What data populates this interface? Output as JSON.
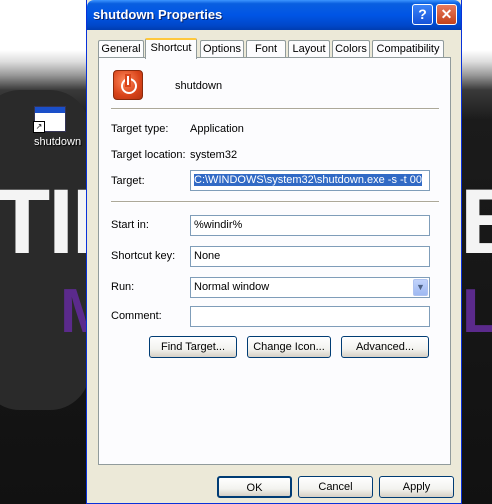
{
  "desktop": {
    "icon_label": "shutdown",
    "background_text": "TIN",
    "background_text_right": "B",
    "background_purple_text": "M",
    "background_purple_text_right": "L"
  },
  "window": {
    "title": "shutdown Properties",
    "help_glyph": "?",
    "close_glyph": "✕"
  },
  "tabs": [
    {
      "label": "General"
    },
    {
      "label": "Shortcut"
    },
    {
      "label": "Options"
    },
    {
      "label": "Font"
    },
    {
      "label": "Layout"
    },
    {
      "label": "Colors"
    },
    {
      "label": "Compatibility"
    }
  ],
  "shortcut": {
    "name": "shutdown",
    "target_type_label": "Target type:",
    "target_type_value": "Application",
    "target_location_label": "Target location:",
    "target_location_value": "system32",
    "target_label": "Target:",
    "target_value": "C:\\WINDOWS\\system32\\shutdown.exe -s -t 00",
    "start_in_label": "Start in:",
    "start_in_value": "%windir%",
    "shortcut_key_label": "Shortcut key:",
    "shortcut_key_value": "None",
    "run_label": "Run:",
    "run_value": "Normal window",
    "comment_label": "Comment:",
    "comment_value": "",
    "find_target_label": "Find Target...",
    "change_icon_label": "Change Icon...",
    "advanced_label": "Advanced..."
  },
  "footer": {
    "ok_label": "OK",
    "cancel_label": "Cancel",
    "apply_label": "Apply"
  },
  "colors": {
    "titlebar": "#0055e5",
    "dialog_bg": "#ece9d8",
    "selection": "#316ac5",
    "active_tab_accent": "#ffc83c"
  }
}
